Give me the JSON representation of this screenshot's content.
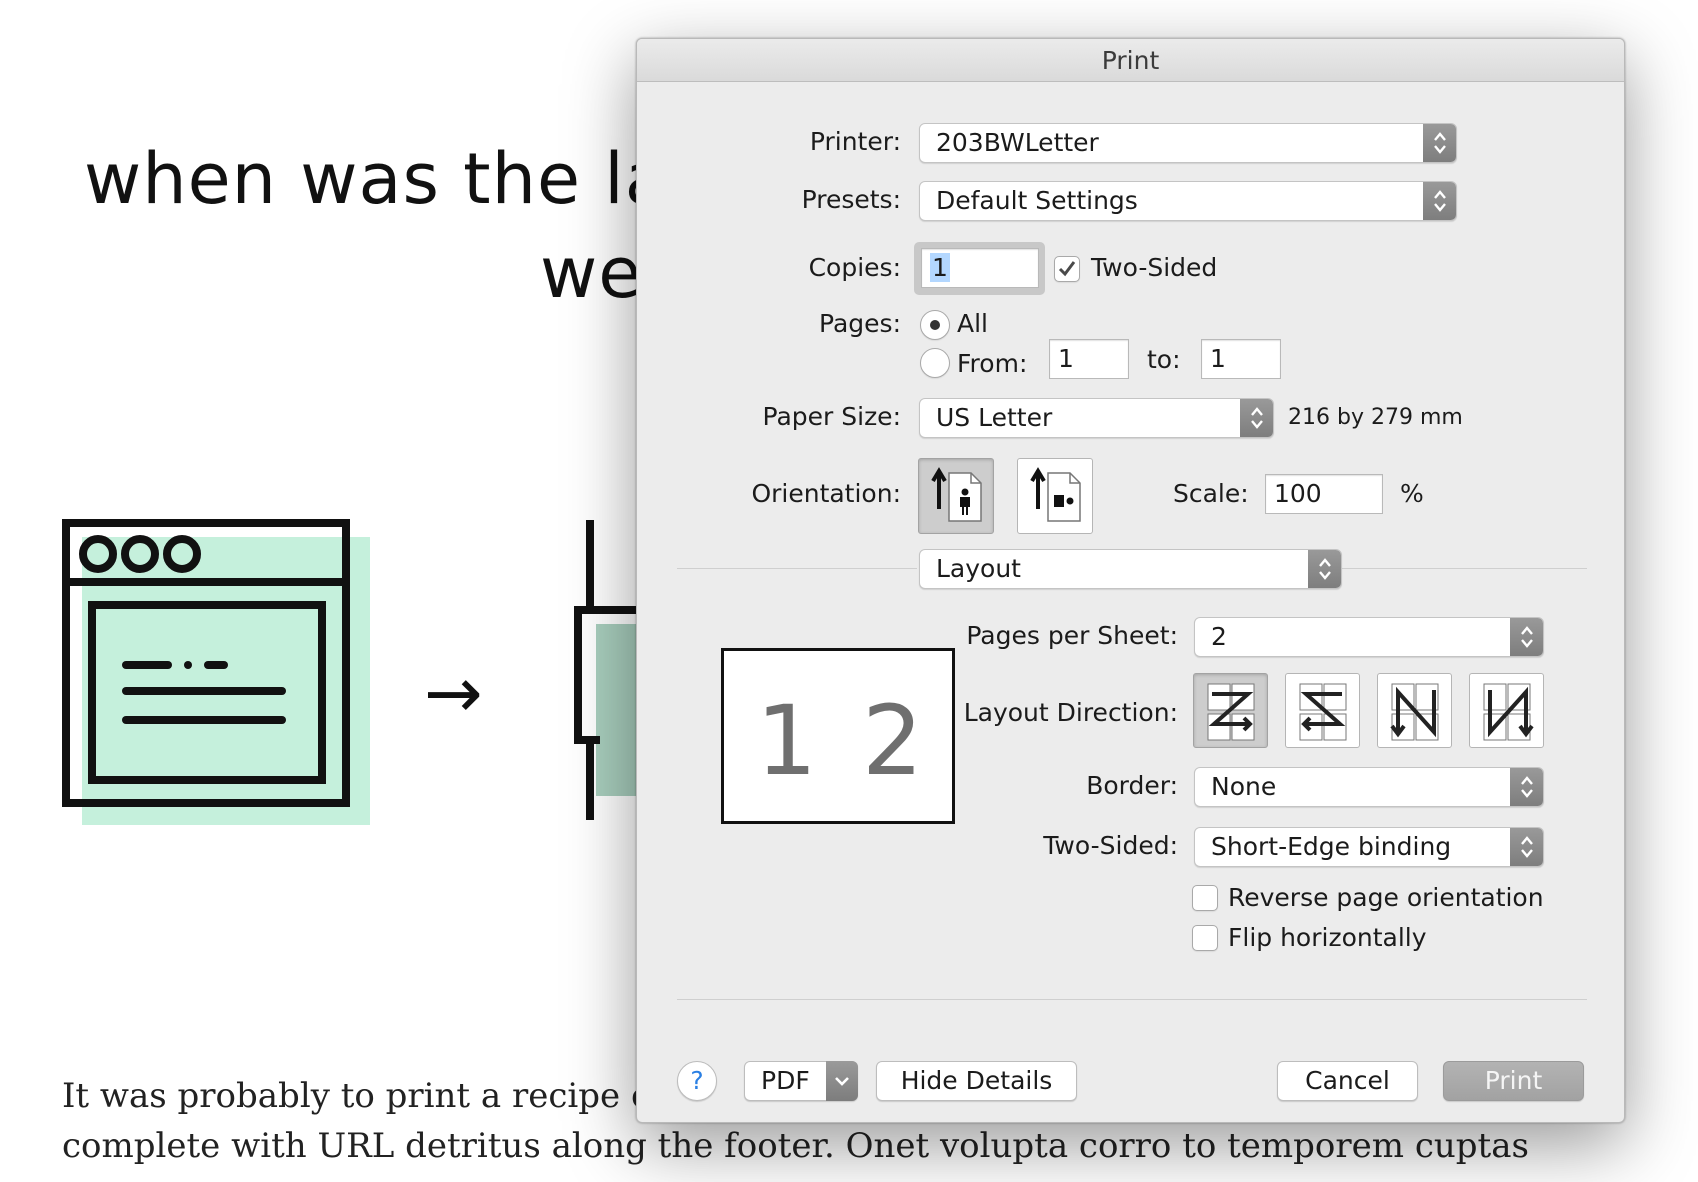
{
  "background": {
    "heading_line1": "when was the las",
    "heading_line2": "we",
    "body_line1": "It was probably to print a recipe or s",
    "body_line2": "complete with URL detritus along the footer. Onet volupta corro to temporem cuptas",
    "illustration_accent": "#c5f0dc"
  },
  "dialog": {
    "title": "Print",
    "printer": {
      "label": "Printer:",
      "value": "203BWLetter"
    },
    "presets": {
      "label": "Presets:",
      "value": "Default Settings"
    },
    "copies": {
      "label": "Copies:",
      "value": "1",
      "two_sided_label": "Two-Sided",
      "two_sided_checked": true
    },
    "pages": {
      "label": "Pages:",
      "all_label": "All",
      "from_label": "From:",
      "from_value": "1",
      "to_label": "to:",
      "to_value": "1",
      "selected": "All"
    },
    "paper_size": {
      "label": "Paper Size:",
      "value": "US Letter",
      "dimensions": "216 by 279 mm"
    },
    "orientation": {
      "label": "Orientation:",
      "selected": "portrait",
      "icons": [
        "portrait-orientation-icon",
        "landscape-orientation-icon"
      ]
    },
    "scale": {
      "label": "Scale:",
      "value": "100",
      "unit": "%"
    },
    "section": {
      "value": "Layout"
    },
    "layout": {
      "pages_per_sheet_label": "Pages per Sheet:",
      "pages_per_sheet_value": "2",
      "layout_direction_label": "Layout Direction:",
      "border_label": "Border:",
      "border_value": "None",
      "two_sided_label": "Two-Sided:",
      "two_sided_value": "Short-Edge binding",
      "reverse_label": "Reverse page orientation",
      "reverse_checked": false,
      "flip_label": "Flip horizontally",
      "flip_checked": false,
      "preview_pages": [
        "1",
        "2"
      ]
    },
    "footer": {
      "help": "?",
      "pdf": "PDF",
      "hide_details": "Hide Details",
      "cancel": "Cancel",
      "print": "Print"
    }
  }
}
